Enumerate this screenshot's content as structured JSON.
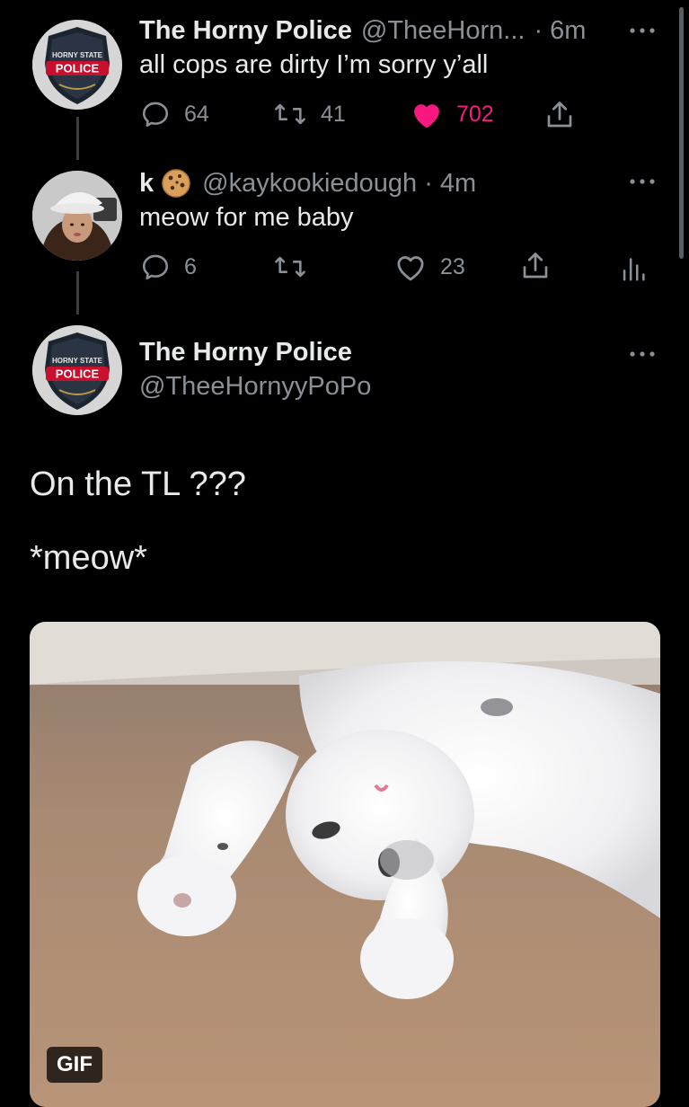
{
  "tweet1": {
    "name": "The Horny Police",
    "handle": "@TheeHorn...",
    "time": "· 6m",
    "text": "all cops are dirty I’m sorry y’all",
    "replies": "64",
    "retweets": "41",
    "likes": "702",
    "liked": true,
    "avatar_badge_top": "HORNY STATE",
    "avatar_badge_main": "POLICE"
  },
  "tweet2": {
    "name": "k",
    "name_emoji": "cookie",
    "handle": "@kaykookiedough",
    "time": "· 4m",
    "text": "meow for me baby",
    "replies": "6",
    "likes": "23"
  },
  "tweet3": {
    "name": "The Horny Police",
    "handle": "@TheeHornyyPoPo",
    "text_line1": "On the TL ???",
    "text_line2": "*meow*",
    "media_badge": "GIF",
    "avatar_badge_top": "HORNY STATE",
    "avatar_badge_main": "POLICE"
  },
  "icons": {
    "more": "more-icon",
    "reply": "reply-icon",
    "retweet": "retweet-icon",
    "like": "heart-icon",
    "share": "share-icon",
    "analytics": "analytics-icon"
  },
  "colors": {
    "background": "#000000",
    "primary_text": "#e7e9ea",
    "secondary_text": "#8b9096",
    "like_pink": "#f91880",
    "badge_red": "#c8102e"
  }
}
